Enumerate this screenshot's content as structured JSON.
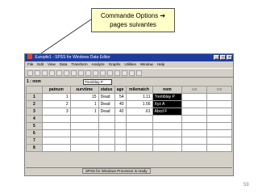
{
  "callout": {
    "line1": "Commande Options ➔",
    "line2": "pages suivantes"
  },
  "window": {
    "title": "Europfe1 - SPSS for Windows Data Editor",
    "menu": [
      "File",
      "Edit",
      "View",
      "Data",
      "Transform",
      "Analyze",
      "Graphs",
      "Utilities",
      "Window",
      "Help"
    ],
    "cell_ref": "1 : nom",
    "cell_value": "Tremblay P"
  },
  "grid": {
    "columns": [
      "patnum",
      "survtime",
      "status",
      "age",
      "milematch",
      "nom",
      "var",
      "var"
    ],
    "rows": [
      {
        "num": "1",
        "cells": [
          "1",
          "15",
          "Dead",
          "54",
          "1.11",
          "Tremblay P",
          "",
          ""
        ]
      },
      {
        "num": "2",
        "cells": [
          "2",
          "1",
          "Dead",
          "40",
          "1.56",
          "Xyz A",
          "",
          ""
        ]
      },
      {
        "num": "3",
        "cells": [
          "3",
          "1",
          "Dead",
          "42",
          ".61",
          "Abcd F",
          "",
          ""
        ]
      },
      {
        "num": "4",
        "cells": [
          "",
          "",
          "",
          "",
          "",
          "",
          "",
          ""
        ]
      },
      {
        "num": "5",
        "cells": [
          "",
          "",
          "",
          "",
          "",
          "",
          "",
          ""
        ]
      },
      {
        "num": "6",
        "cells": [
          "",
          "",
          "",
          "",
          "",
          "",
          "",
          ""
        ]
      },
      {
        "num": "7",
        "cells": [
          "",
          "",
          "",
          "",
          "",
          "",
          "",
          ""
        ]
      },
      {
        "num": "8",
        "cells": [
          "",
          "",
          "",
          "",
          "",
          "",
          "",
          ""
        ]
      }
    ]
  },
  "status": "SPSS for Windows Processor is ready",
  "page_number": "59"
}
